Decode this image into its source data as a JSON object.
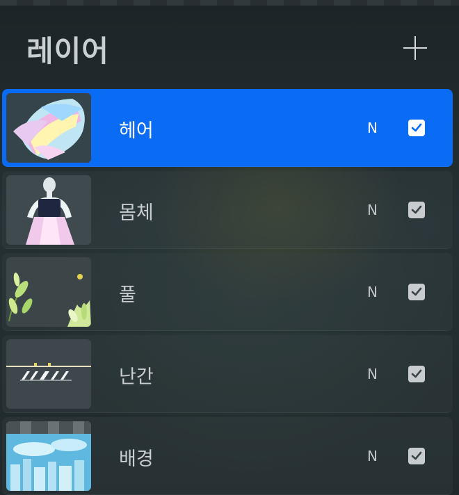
{
  "panel": {
    "title": "레이어",
    "add_icon": "plus-icon"
  },
  "layers": [
    {
      "name": "헤어",
      "mode": "N",
      "visible": true,
      "selected": true
    },
    {
      "name": "몸체",
      "mode": "N",
      "visible": true,
      "selected": false
    },
    {
      "name": "풀",
      "mode": "N",
      "visible": true,
      "selected": false
    },
    {
      "name": "난간",
      "mode": "N",
      "visible": true,
      "selected": false
    },
    {
      "name": "배경",
      "mode": "N",
      "visible": true,
      "selected": false
    }
  ],
  "colors": {
    "selected_row": "#0a6cf5",
    "checkbox": "#c8ccce",
    "text": "#c9cdd0"
  }
}
